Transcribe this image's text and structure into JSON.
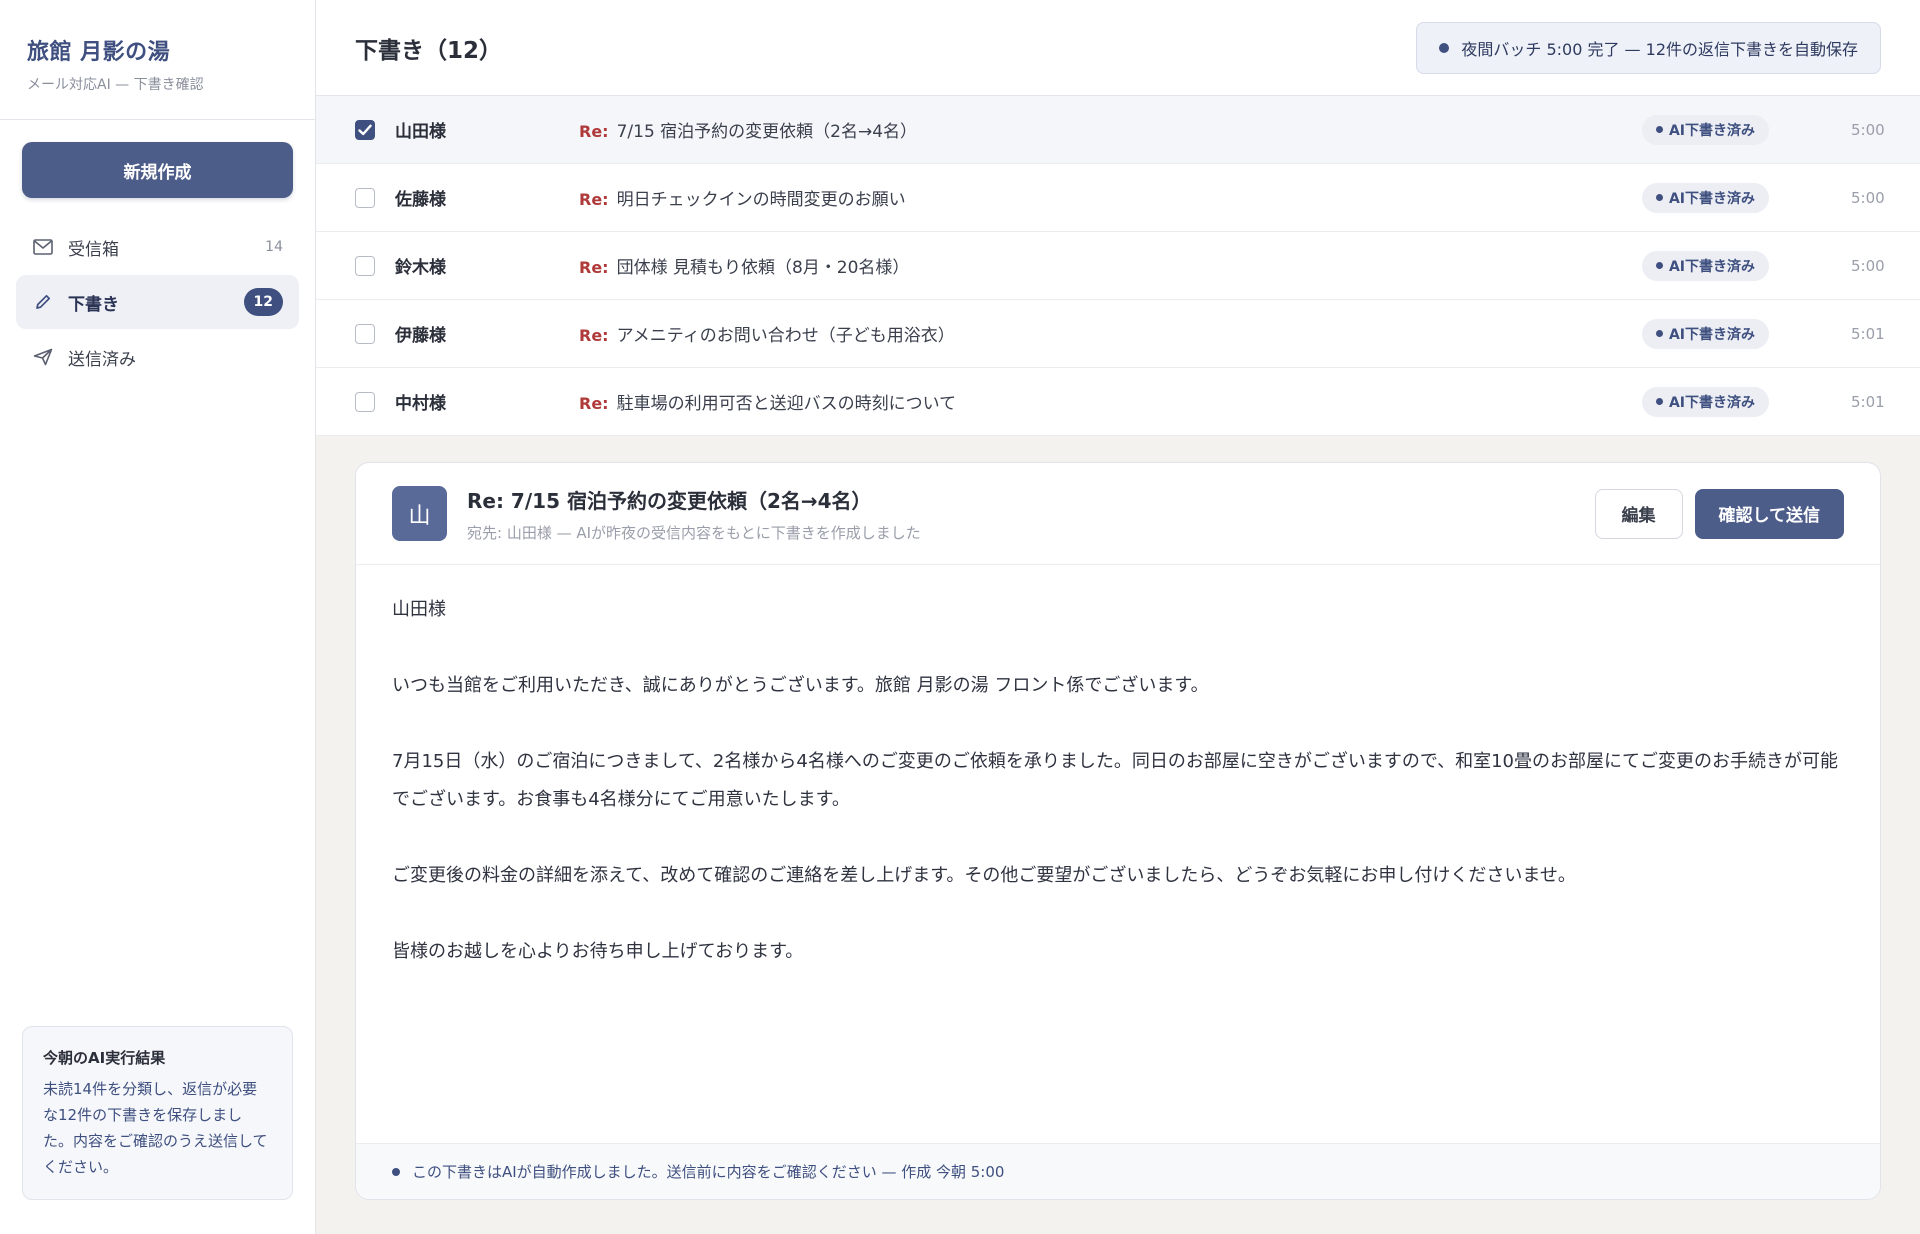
{
  "brand": {
    "title": "旅館 月影の湯",
    "subtitle": "メール対応AI — 下書き確認"
  },
  "compose_label": "新規作成",
  "nav": [
    {
      "label": "受信箱",
      "count": "14",
      "icon": "mail-icon"
    },
    {
      "label": "下書き",
      "count": "12",
      "icon": "pencil-icon"
    },
    {
      "label": "送信済み",
      "count": "",
      "icon": "send-icon"
    }
  ],
  "ai_result": {
    "title": "今朝のAI実行結果",
    "text": "未読14件を分類し、返信が必要な12件の下書きを保存しました。内容をご確認のうえ送信してください。"
  },
  "topbar": {
    "title": "下書き（12）",
    "batch_status": "夜間バッチ 5:00 完了 — 12件の返信下書きを自動保存"
  },
  "list": [
    {
      "sender": "山田様",
      "re": "Re:",
      "subject": "7/15 宿泊予約の変更依頼（2名→4名）",
      "badge": "AI下書き済み",
      "time": "5:00",
      "checked": true
    },
    {
      "sender": "佐藤様",
      "re": "Re:",
      "subject": "明日チェックインの時間変更のお願い",
      "badge": "AI下書き済み",
      "time": "5:00",
      "checked": false
    },
    {
      "sender": "鈴木様",
      "re": "Re:",
      "subject": "団体様 見積もり依頼（8月・20名様）",
      "badge": "AI下書き済み",
      "time": "5:00",
      "checked": false
    },
    {
      "sender": "伊藤様",
      "re": "Re:",
      "subject": "アメニティのお問い合わせ（子ども用浴衣）",
      "badge": "AI下書き済み",
      "time": "5:01",
      "checked": false
    },
    {
      "sender": "中村様",
      "re": "Re:",
      "subject": "駐車場の利用可否と送迎バスの時刻について",
      "badge": "AI下書き済み",
      "time": "5:01",
      "checked": false
    }
  ],
  "preview": {
    "avatar": "山",
    "subject": "Re: 7/15 宿泊予約の変更依頼（2名→4名）",
    "to": "宛先: 山田様 — AIが昨夜の受信内容をもとに下書きを作成しました",
    "edit_label": "編集",
    "send_label": "確認して送信",
    "body": [
      "山田様",
      "いつも当館をご利用いただき、誠にありがとうございます。旅館 月影の湯 フロント係でございます。",
      "7月15日（水）のご宿泊につきまして、2名様から4名様へのご変更のご依頼を承りました。同日のお部屋に空きがございますので、和室10畳のお部屋にてご変更のお手続きが可能でございます。お食事も4名様分にてご用意いたします。",
      "ご変更後の料金の詳細を添えて、改めて確認のご連絡を差し上げます。その他ご要望がございましたら、どうぞお気軽にお申し付けくださいませ。",
      "皆様のお越しを心よりお待ち申し上げております。"
    ],
    "footer": "この下書きはAIが自動作成しました。送信前に内容をご確認ください — 作成 今朝 5:00"
  }
}
